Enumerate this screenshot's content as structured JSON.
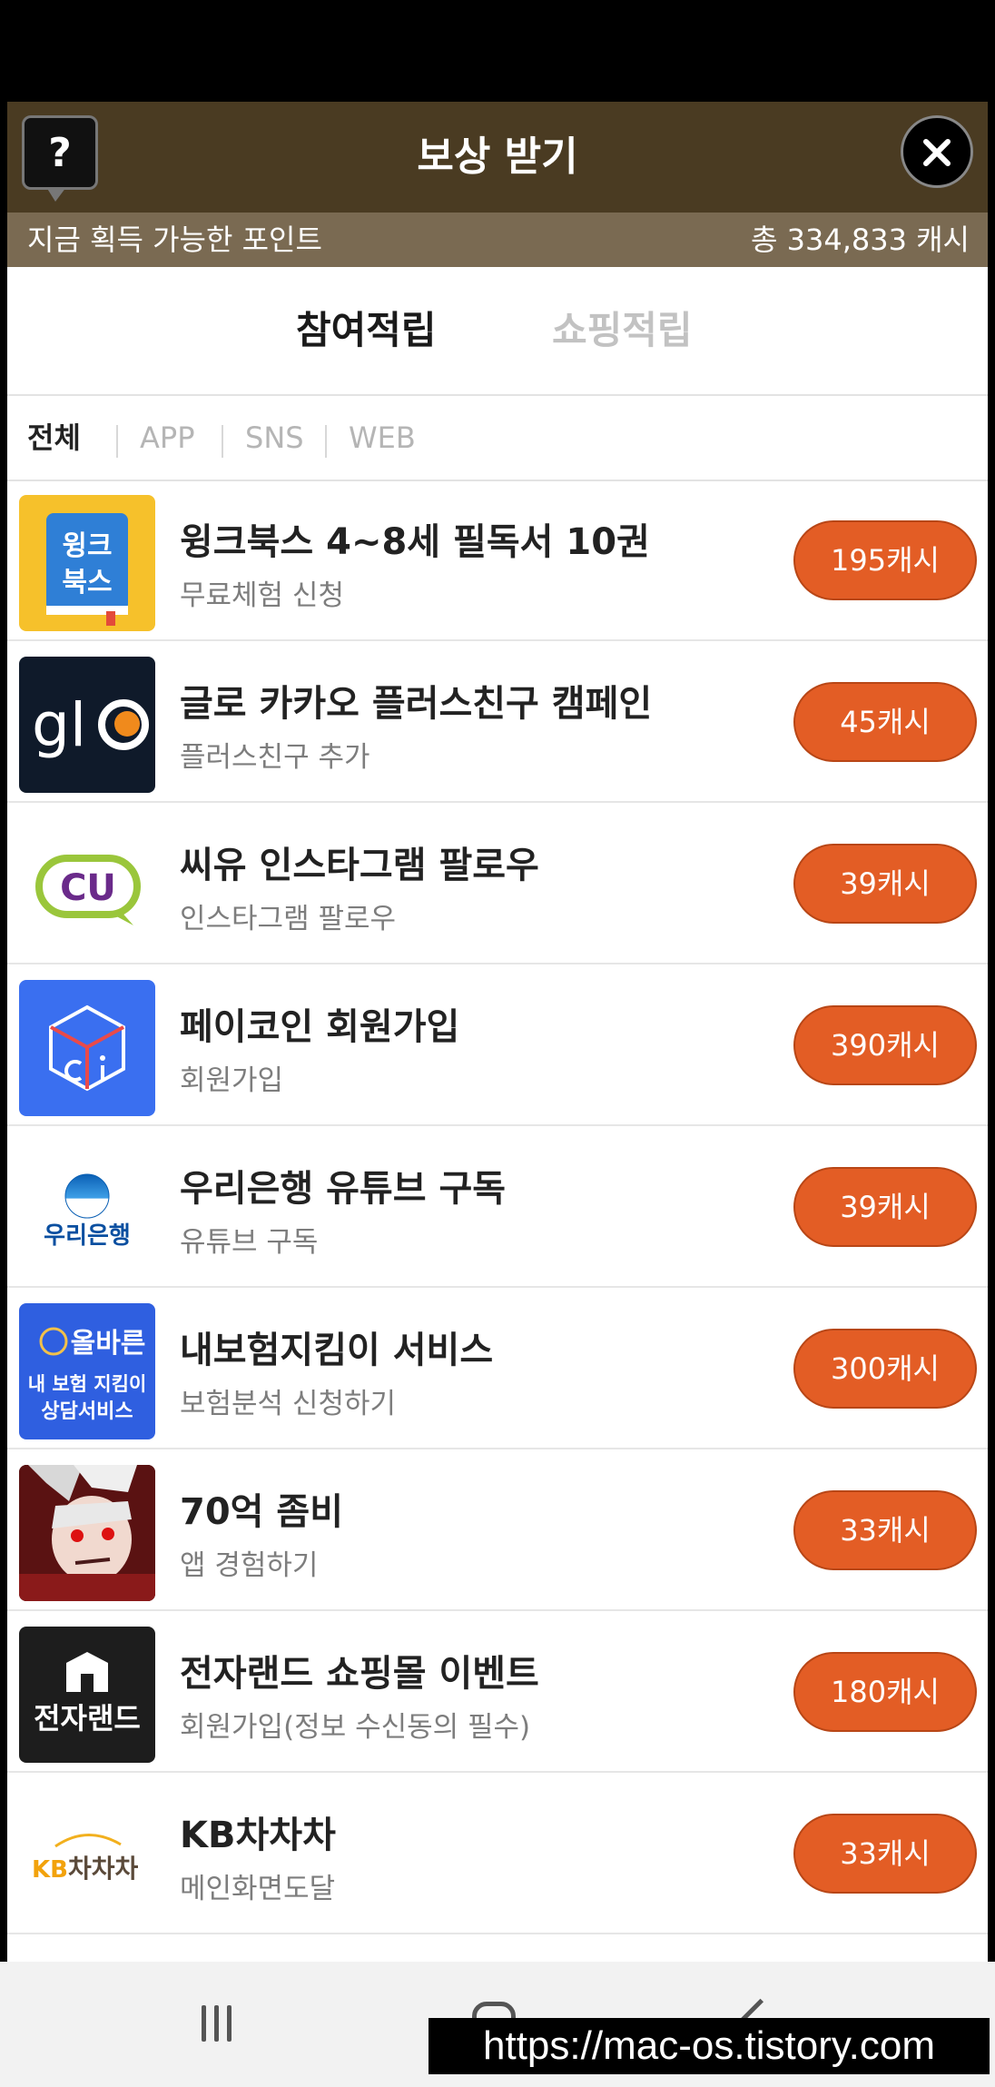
{
  "header": {
    "title": "보상 받기",
    "help_label": "?"
  },
  "points_bar": {
    "label": "지금 획득 가능한 포인트",
    "total": "총 334,833 캐시"
  },
  "tabs": [
    {
      "label": "참여적립",
      "active": true
    },
    {
      "label": "쇼핑적립",
      "active": false
    }
  ],
  "filters": [
    {
      "label": "전체",
      "active": true
    },
    {
      "label": "APP",
      "active": false
    },
    {
      "label": "SNS",
      "active": false
    },
    {
      "label": "WEB",
      "active": false
    }
  ],
  "offers": [
    {
      "title": "윙크북스 4~8세 필독서 10권",
      "subtitle": "무료체험 신청",
      "reward": "195캐시",
      "logo": "wink-books-logo",
      "logo_text": "윙크\n북스"
    },
    {
      "title": "글로 카카오 플러스친구 캠페인",
      "subtitle": "플러스친구 추가",
      "reward": "45캐시",
      "logo": "glo-logo",
      "logo_text": "glo"
    },
    {
      "title": "씨유 인스타그램 팔로우",
      "subtitle": "인스타그램 팔로우",
      "reward": "39캐시",
      "logo": "cu-logo",
      "logo_text": "CU"
    },
    {
      "title": "페이코인 회원가입",
      "subtitle": "회원가입",
      "reward": "390캐시",
      "logo": "paycoin-logo",
      "logo_text": ""
    },
    {
      "title": "우리은행 유튜브 구독",
      "subtitle": "유튜브 구독",
      "reward": "39캐시",
      "logo": "woori-bank-logo",
      "logo_text": "우리은행"
    },
    {
      "title": "내보험지킴이 서비스",
      "subtitle": "보험분석 신청하기",
      "reward": "300캐시",
      "logo": "insurance-logo",
      "logo_text": "올바른\n내 보험 지킴이\n상담서비스"
    },
    {
      "title": "70억 좀비",
      "subtitle": "앱 경험하기",
      "reward": "33캐시",
      "logo": "zombie-game-logo",
      "logo_text": ""
    },
    {
      "title": "전자랜드 쇼핑몰 이벤트",
      "subtitle": "회원가입(정보 수신동의 필수)",
      "reward": "180캐시",
      "logo": "etland-logo",
      "logo_text": "전자랜드"
    },
    {
      "title": "KB차차차",
      "subtitle": "메인화면도달",
      "reward": "33캐시",
      "logo": "kb-chachacha-logo",
      "logo_text": "KB차차차"
    }
  ],
  "watermark": "https://mac-os.tistory.com",
  "colors": {
    "header_bg": "#4a3b22",
    "points_bar_bg": "#7a6a52",
    "reward_button": "#e35d25"
  }
}
